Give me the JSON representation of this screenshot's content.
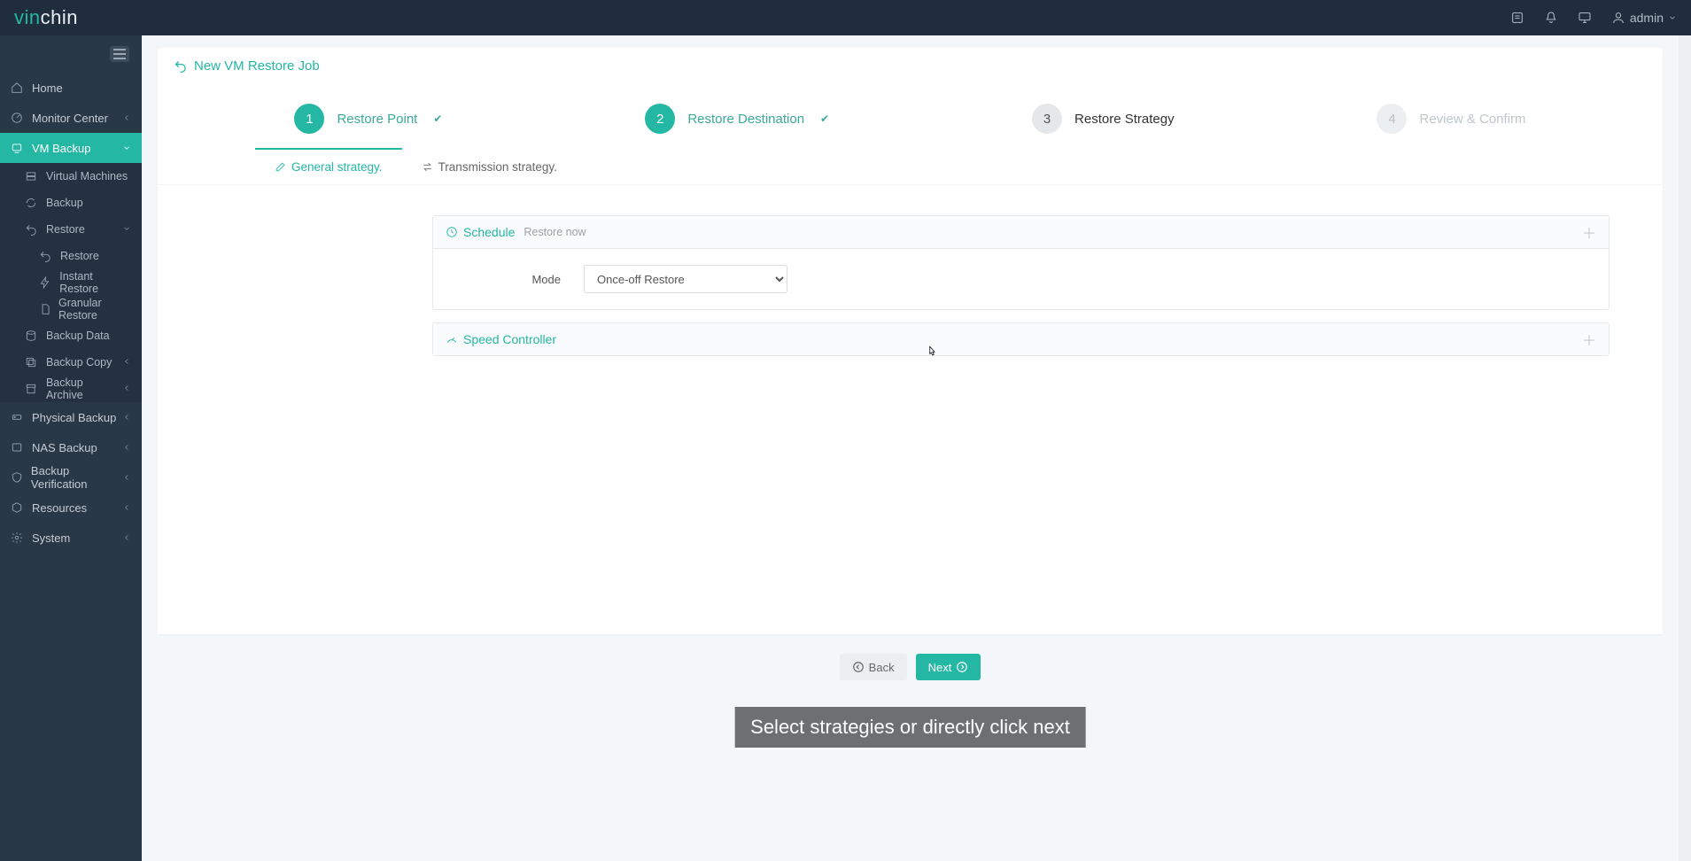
{
  "topbar": {
    "logo_prefix": "vin",
    "logo_suffix": "chin",
    "user": "admin"
  },
  "sidebar": {
    "home": "Home",
    "monitor": "Monitor Center",
    "vmbackup": "VM Backup",
    "vms": "Virtual Machines",
    "backup": "Backup",
    "restore": "Restore",
    "restore_sub": "Restore",
    "instant": "Instant Restore",
    "granular": "Granular Restore",
    "backup_data": "Backup Data",
    "backup_copy": "Backup Copy",
    "backup_archive": "Backup Archive",
    "physical": "Physical Backup",
    "nas": "NAS Backup",
    "verification": "Backup Verification",
    "resources": "Resources",
    "system": "System"
  },
  "page": {
    "title": "New VM Restore Job"
  },
  "steps": {
    "s1": {
      "num": "1",
      "label": "Restore Point"
    },
    "s2": {
      "num": "2",
      "label": "Restore Destination"
    },
    "s3": {
      "num": "3",
      "label": "Restore Strategy"
    },
    "s4": {
      "num": "4",
      "label": "Review & Confirm"
    }
  },
  "tabs": {
    "general": "General strategy.",
    "transmission": "Transmission strategy."
  },
  "panels": {
    "schedule": {
      "title": "Schedule",
      "subtitle": "Restore now"
    },
    "speed": {
      "title": "Speed Controller"
    }
  },
  "form": {
    "mode_label": "Mode",
    "mode_value": "Once-off Restore",
    "mode_options": [
      "Once-off Restore"
    ]
  },
  "buttons": {
    "back": "Back",
    "next": "Next"
  },
  "caption": "Select strategies or directly click next"
}
